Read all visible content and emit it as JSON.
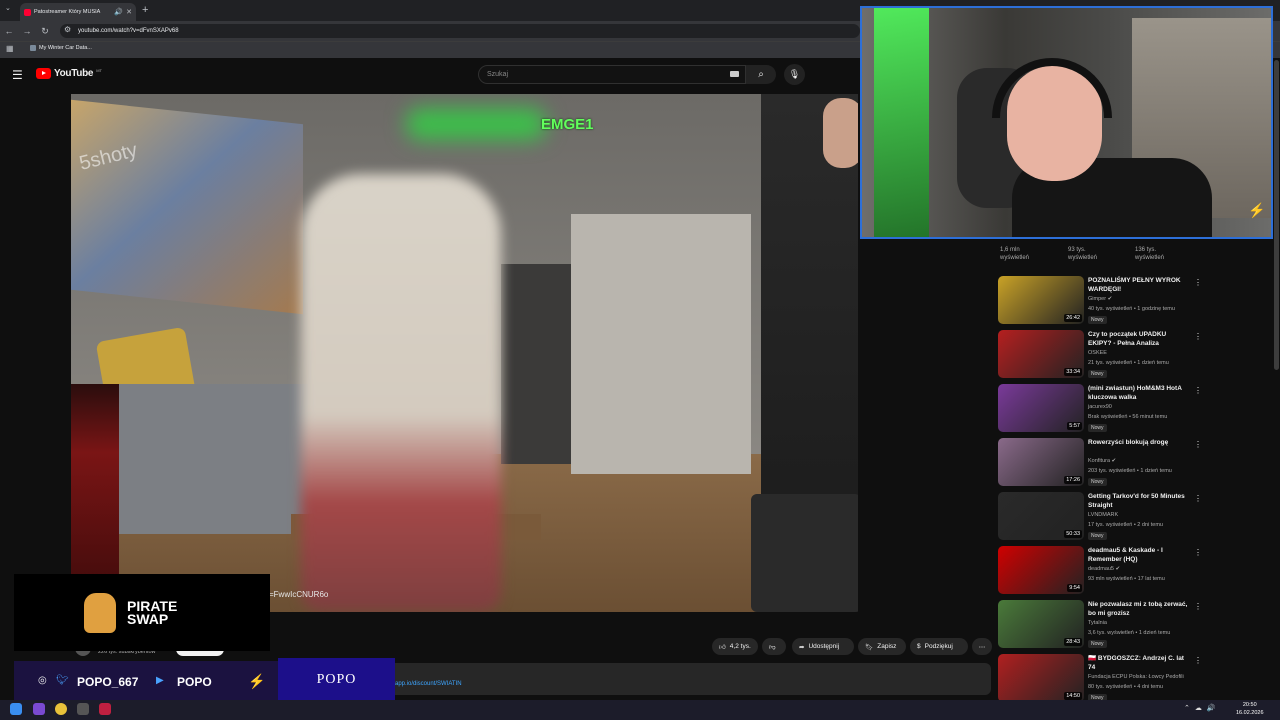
{
  "browser": {
    "tab_title": "Patostreamer Który MUSIA",
    "new_tab_symbol": "+",
    "url": "youtube.com/watch?v=dFvnSXAPv68",
    "bookmark_label": "My Winter Car Data..."
  },
  "youtube": {
    "logo_text": "YouTube",
    "logo_region": "MT",
    "search_placeholder": "Szukaj"
  },
  "video": {
    "watermark": "5shoty",
    "overlay_name": "EMGE1",
    "overlay_url": "=FwwIcCNUR6o"
  },
  "below_video": {
    "subscribers": "226 tys. subskrybentów",
    "actions": [
      {
        "icon": "thumbs-up",
        "label": "4,2 tys."
      },
      {
        "icon": "thumbs-down",
        "label": ""
      },
      {
        "icon": "share",
        "label": "Udostępnij"
      },
      {
        "icon": "bookmark",
        "label": "Zapisz"
      },
      {
        "icon": "dollar",
        "label": "Podziękuj"
      },
      {
        "icon": "more",
        "label": "⋯"
      }
    ],
    "description_link": "app.io/discount/SWIATIN"
  },
  "partial_stats": [
    {
      "views": "1,6 mln",
      "word": "wyświetleń"
    },
    {
      "views": "93 tys.",
      "word": "wyświetleń"
    },
    {
      "views": "136 tys.",
      "word": "wyświetleń"
    }
  ],
  "recommendations": [
    {
      "title": "POZNALIŚMY PEŁNY WYROK WARDĘGI!",
      "channel": "Gimper",
      "verified": true,
      "meta": "40 tys. wyświetleń • 1 godzinę temu",
      "duration": "26:42",
      "badge": "Nowy",
      "thumb_color": "#c9a227"
    },
    {
      "title": "Czy to początek UPADKU EKIPY? - Pełna Analiza",
      "channel": "OSKEE",
      "verified": false,
      "meta": "21 tys. wyświetleń • 1 dzień temu",
      "duration": "33:34",
      "badge": "Nowy",
      "thumb_color": "#b51f1f"
    },
    {
      "title": "(mini zwiastun) HoM&M3 HotA kluczowa walka",
      "channel": "jacurex90",
      "verified": false,
      "meta": "Brak wyświetleń • 56 minut temu",
      "duration": "5:57",
      "badge": "Nowy",
      "thumb_color": "#7a3a9a"
    },
    {
      "title": "Rowerzyści blokują drogę",
      "channel": "Konfitura",
      "verified": true,
      "meta": "203 tys. wyświetleń • 1 dzień temu",
      "duration": "17:26",
      "badge": "Nowy",
      "thumb_color": "#8a6a8a"
    },
    {
      "title": "Getting Tarkov'd for 50 Minutes Straight",
      "channel": "LVNDMARK",
      "verified": false,
      "meta": "17 tys. wyświetleń • 2 dni temu",
      "duration": "50:33",
      "badge": "Nowy",
      "thumb_color": "#2a2a2a"
    },
    {
      "title": "deadmau5 & Kaskade - I Remember (HQ)",
      "channel": "deadmau5",
      "verified": true,
      "meta": "93 mln wyświetleń • 17 lat temu",
      "duration": "9:54",
      "badge": "",
      "thumb_color": "#d00000"
    },
    {
      "title": "Nie pozwalasz mi z tobą zerwać, bo mi grozisz",
      "channel": "Tytalnia",
      "verified": false,
      "meta": "3,6 tys. wyświetleń • 1 dzień temu",
      "duration": "28:43",
      "badge": "Nowy",
      "thumb_color": "#4a7a3a"
    },
    {
      "title": "🇵🇱 BYDGOSZCZ: Andrzej C. lat 74",
      "channel": "Fundacja ECPU Polska: Łowcy Pedofili",
      "verified": false,
      "meta": "80 tys. wyświetleń • 4 dni temu",
      "duration": "14:50",
      "badge": "Nowy",
      "thumb_color": "#b02020"
    }
  ],
  "overlay": {
    "sponsor_line1": "PIRATE",
    "sponsor_line2": "SWAP",
    "handle1": "POPO_667",
    "handle2": "POPO",
    "brand": "POPO"
  },
  "taskbar": {
    "time": "20:50",
    "date": "16.02.2026"
  }
}
